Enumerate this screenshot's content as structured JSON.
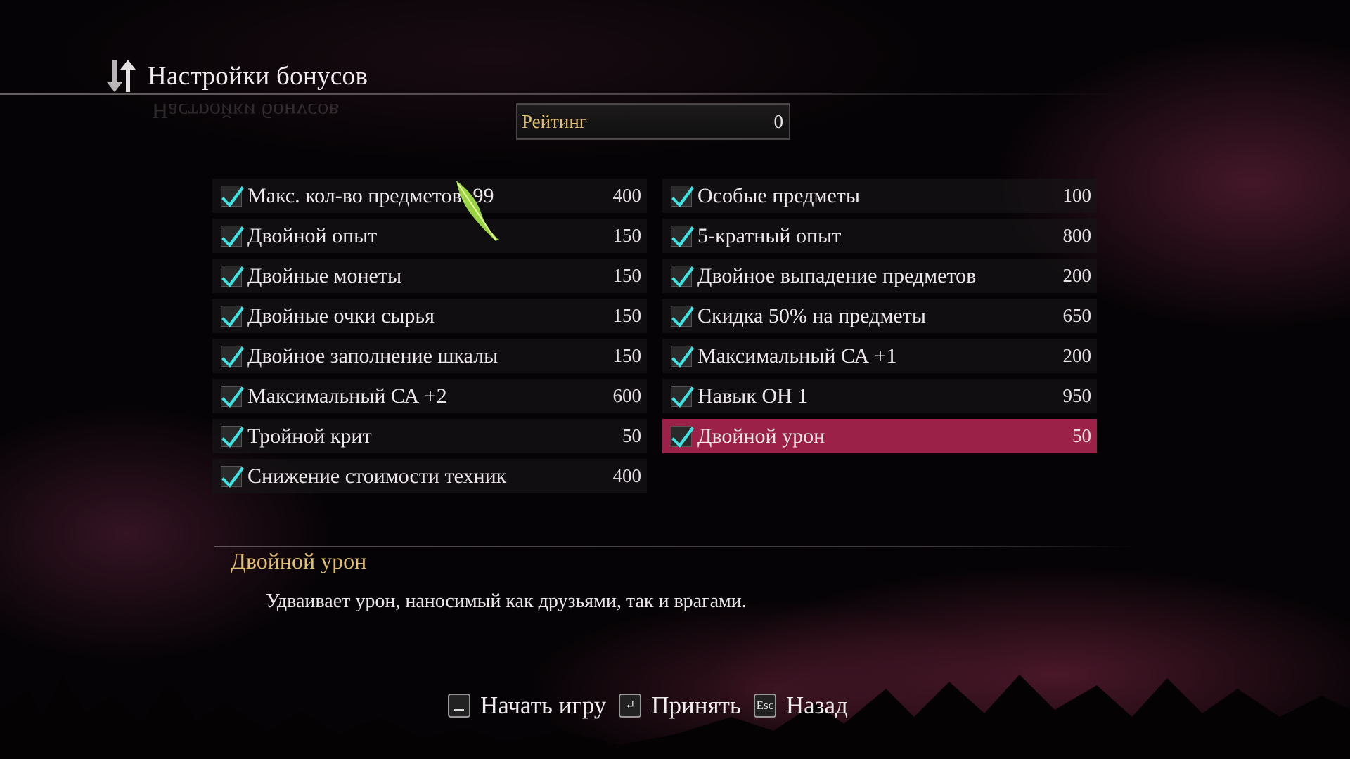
{
  "header": {
    "title": "Настройки бонусов",
    "icon": "sort-arrows-icon"
  },
  "rating": {
    "label": "Рейтинг",
    "value": "0"
  },
  "columns": {
    "left": [
      {
        "label": "Макс. кол-во предметов: 99",
        "cost": "400",
        "checked": true
      },
      {
        "label": "Двойной опыт",
        "cost": "150",
        "checked": true
      },
      {
        "label": "Двойные монеты",
        "cost": "150",
        "checked": true
      },
      {
        "label": "Двойные очки сырья",
        "cost": "150",
        "checked": true
      },
      {
        "label": "Двойное заполнение шкалы",
        "cost": "150",
        "checked": true
      },
      {
        "label": "Максимальный СА +2",
        "cost": "600",
        "checked": true
      },
      {
        "label": "Тройной крит",
        "cost": "50",
        "checked": true
      },
      {
        "label": "Снижение стоимости техник",
        "cost": "400",
        "checked": true
      }
    ],
    "right": [
      {
        "label": "Особые предметы",
        "cost": "100",
        "checked": true
      },
      {
        "label": "5-кратный опыт",
        "cost": "800",
        "checked": true
      },
      {
        "label": "Двойное выпадение предметов",
        "cost": "200",
        "checked": true
      },
      {
        "label": "Скидка 50% на предметы",
        "cost": "650",
        "checked": true
      },
      {
        "label": "Максимальный СА +1",
        "cost": "200",
        "checked": true
      },
      {
        "label": "Навык ОН 1",
        "cost": "950",
        "checked": true
      },
      {
        "label": "Двойной урон",
        "cost": "50",
        "checked": true,
        "selected": true
      }
    ]
  },
  "description": {
    "title": "Двойной урон",
    "text": "Удваивает урон, наносимый как друзьями, так и врагами."
  },
  "footer": {
    "start": {
      "key": "space-key-icon",
      "label": "Начать игру"
    },
    "accept": {
      "key": "enter-key-icon",
      "label": "Принять"
    },
    "back": {
      "key": "Esc",
      "label": "Назад"
    }
  },
  "colors": {
    "accent_gold": "#e0bf6e",
    "selection": "#9b2148",
    "check": "#3fe3e3"
  }
}
